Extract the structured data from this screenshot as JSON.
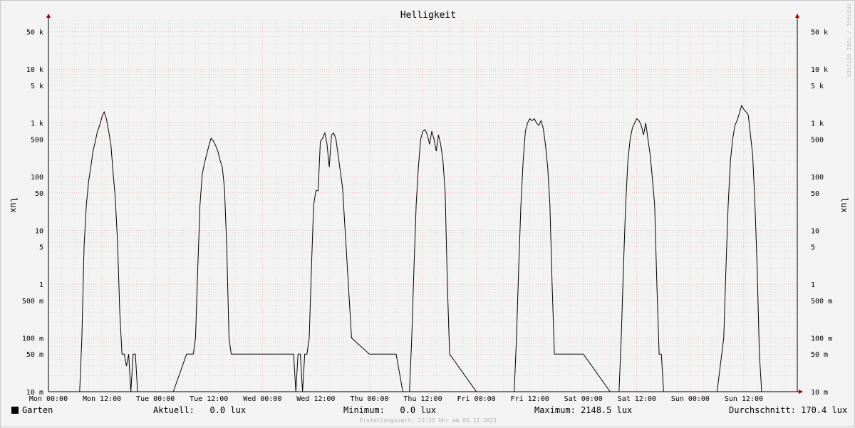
{
  "chart_data": {
    "type": "line",
    "title": "Helligkeit",
    "ylabel": "lux",
    "yscale": "log",
    "ylim": [
      0.01,
      80000
    ],
    "xlim_hours": [
      0,
      168
    ],
    "grid": true,
    "y_ticks": [
      {
        "value": 0.01,
        "label": "10 m"
      },
      {
        "value": 0.05,
        "label": "50 m"
      },
      {
        "value": 0.1,
        "label": "100 m"
      },
      {
        "value": 0.5,
        "label": "500 m"
      },
      {
        "value": 1,
        "label": "1"
      },
      {
        "value": 5,
        "label": "5"
      },
      {
        "value": 10,
        "label": "10"
      },
      {
        "value": 50,
        "label": "50"
      },
      {
        "value": 100,
        "label": "100"
      },
      {
        "value": 500,
        "label": "500"
      },
      {
        "value": 1000,
        "label": "1 k"
      },
      {
        "value": 5000,
        "label": "5 k"
      },
      {
        "value": 10000,
        "label": "10 k"
      },
      {
        "value": 50000,
        "label": "50 k"
      }
    ],
    "x_ticks": [
      "Mon 00:00",
      "Mon 12:00",
      "Tue 00:00",
      "Tue 12:00",
      "Wed 00:00",
      "Wed 12:00",
      "Thu 00:00",
      "Thu 12:00",
      "Fri 00:00",
      "Fri 12:00",
      "Sat 00:00",
      "Sat 12:00",
      "Sun 00:00",
      "Sun 12:00"
    ],
    "series": [
      {
        "name": "Garten",
        "color": "#000000",
        "x_hours": [
          0,
          7,
          7.5,
          8,
          8.5,
          9,
          9.5,
          10,
          10.5,
          11,
          11.5,
          12,
          12.5,
          13,
          13.5,
          14,
          14.5,
          15,
          15.5,
          16,
          16.5,
          17,
          17.5,
          18,
          18.5,
          19,
          19.5,
          20,
          20.5,
          21,
          24,
          28,
          31,
          31.5,
          32,
          32.5,
          33,
          33.5,
          34,
          34.5,
          35,
          35.5,
          36,
          36.5,
          37,
          37.5,
          38,
          38.5,
          39,
          39.5,
          40,
          40.5,
          41,
          42,
          44,
          48,
          52,
          55,
          55.5,
          56,
          56.5,
          57,
          57.5,
          58,
          58.5,
          59,
          59.5,
          60,
          60.5,
          61,
          61.5,
          62,
          62.5,
          63,
          63.5,
          64,
          64.5,
          65,
          66,
          68,
          72,
          78,
          79.5,
          80,
          80.5,
          81,
          81.5,
          82,
          82.5,
          83,
          83.5,
          84,
          84.5,
          85,
          85.5,
          86,
          86.5,
          87,
          87.5,
          88,
          88.5,
          89,
          89.5,
          90,
          96,
          103,
          103.5,
          104,
          104.5,
          105,
          105.5,
          106,
          106.5,
          107,
          107.5,
          108,
          108.5,
          109,
          109.5,
          110,
          110.5,
          111,
          111.5,
          112,
          112.5,
          113,
          113.5,
          114,
          116,
          120,
          126,
          127.5,
          128,
          128.5,
          129,
          129.5,
          130,
          130.5,
          131,
          131.5,
          132,
          132.5,
          133,
          133.5,
          134,
          134.5,
          135,
          135.5,
          136,
          136.5,
          137,
          137.5,
          138,
          140,
          144,
          150,
          151.5,
          152,
          152.5,
          153,
          153.5,
          154,
          154.5,
          155,
          155.5,
          156,
          156.5,
          157,
          157.5,
          158,
          158.5,
          159,
          159.5,
          160,
          160.5,
          161,
          161.5,
          162,
          168
        ],
        "values": [
          0.01,
          0.01,
          0.1,
          5,
          30,
          80,
          150,
          300,
          450,
          700,
          900,
          1300,
          1600,
          1200,
          700,
          400,
          120,
          40,
          6,
          0.3,
          0.05,
          0.05,
          0.03,
          0.05,
          0.01,
          0.05,
          0.05,
          0.01,
          0.01,
          0.01,
          0.01,
          0.01,
          0.05,
          0.05,
          0.05,
          0.05,
          0.1,
          2,
          30,
          110,
          180,
          260,
          380,
          520,
          460,
          380,
          300,
          200,
          150,
          60,
          5,
          0.1,
          0.05,
          0.05,
          0.05,
          0.05,
          0.05,
          0.05,
          0.01,
          0.05,
          0.05,
          0.01,
          0.05,
          0.05,
          0.1,
          2,
          30,
          55,
          55,
          450,
          520,
          650,
          400,
          150,
          600,
          650,
          500,
          250,
          60,
          0.1,
          0.05,
          0.05,
          0.01,
          0.01,
          0.01,
          0.01,
          0.1,
          2,
          30,
          150,
          500,
          700,
          750,
          600,
          400,
          700,
          500,
          300,
          600,
          400,
          200,
          50,
          1,
          0.05,
          0.01,
          0.01,
          0.01,
          0.01,
          0.01,
          0.1,
          2,
          30,
          200,
          700,
          1000,
          1200,
          1100,
          1200,
          1000,
          900,
          1100,
          800,
          400,
          150,
          30,
          1,
          0.05,
          0.05,
          0.05,
          0.05,
          0.01,
          0.01,
          0.01,
          0.1,
          2,
          30,
          200,
          500,
          800,
          1000,
          1200,
          1100,
          900,
          600,
          1000,
          500,
          250,
          90,
          30,
          1,
          0.05,
          0.05,
          0.01,
          0.01,
          0.01,
          0.01,
          0.1,
          2,
          30,
          200,
          500,
          900,
          1100,
          1500,
          2100,
          1800,
          1600,
          1400,
          600,
          250,
          30,
          2,
          0.05,
          0.01
        ]
      }
    ]
  },
  "legend": {
    "series_name": "Garten",
    "current": "Aktuell:   0.0 lux",
    "minimum": "Minimum:   0.0 lux",
    "maximum": "Maximum: 2148.5 lux",
    "average": "Durchschnitt: 170.4 lux"
  },
  "footer": "Erstellungszeit: 23:55 Uhr am 05.12.2021",
  "watermark": "RRDTOOL / TOBI OETIKER"
}
